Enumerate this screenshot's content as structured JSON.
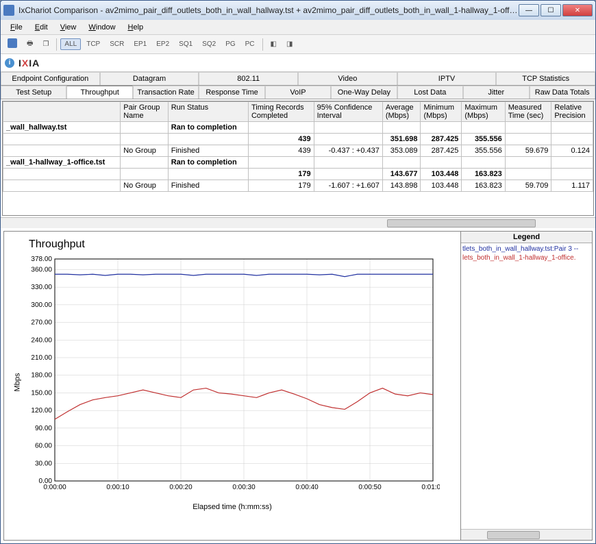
{
  "window": {
    "title": "IxChariot Comparison - av2mimo_pair_diff_outlets_both_in_wall_hallway.tst + av2mimo_pair_diff_outlets_both_in_wall_1-hallway_1-offic..."
  },
  "menu": {
    "file": "File",
    "edit": "Edit",
    "view": "View",
    "window": "Window",
    "help": "Help"
  },
  "toolbar": {
    "save_icon": "disk",
    "print_icon": "print",
    "all": "ALL",
    "tcp": "TCP",
    "scr": "SCR",
    "ep1": "EP1",
    "ep2": "EP2",
    "sq1": "SQ1",
    "sq2": "SQ2",
    "pg": "PG",
    "pc": "PC"
  },
  "brand": {
    "name_left": "I",
    "name_x": "X",
    "name_right": "IA"
  },
  "tabs_top": [
    "Endpoint Configuration",
    "Datagram",
    "802.11",
    "Video",
    "IPTV",
    "TCP Statistics"
  ],
  "tabs_bottom": [
    "Test Setup",
    "Throughput",
    "Transaction Rate",
    "Response Time",
    "VoIP",
    "One-Way Delay",
    "Lost Data",
    "Jitter",
    "Raw Data Totals"
  ],
  "tabs_bottom_selected": 1,
  "grid": {
    "headers": [
      "",
      "Pair Group\nName",
      "Run Status",
      "Timing Records\nCompleted",
      "95% Confidence\nInterval",
      "Average\n(Mbps)",
      "Minimum\n(Mbps)",
      "Maximum\n(Mbps)",
      "Measured\nTime (sec)",
      "Relative\nPrecision"
    ],
    "rows": [
      {
        "bold": true,
        "cells": [
          "_wall_hallway.tst",
          "",
          "Ran to completion",
          "",
          "",
          "",
          "",
          "",
          "",
          ""
        ]
      },
      {
        "bold": true,
        "cells": [
          "",
          "",
          "",
          "439",
          "",
          "351.698",
          "287.425",
          "355.556",
          "",
          ""
        ]
      },
      {
        "cells": [
          "",
          "No Group",
          "Finished",
          "439",
          "-0.437 : +0.437",
          "353.089",
          "287.425",
          "355.556",
          "59.679",
          "0.124"
        ]
      },
      {
        "bold": true,
        "cells": [
          "_wall_1-hallway_1-office.tst",
          "",
          "Ran to completion",
          "",
          "",
          "",
          "",
          "",
          "",
          ""
        ]
      },
      {
        "bold": true,
        "cells": [
          "",
          "",
          "",
          "179",
          "",
          "143.677",
          "103.448",
          "163.823",
          "",
          ""
        ]
      },
      {
        "cells": [
          "",
          "No Group",
          "Finished",
          "179",
          "-1.607 : +1.607",
          "143.898",
          "103.448",
          "163.823",
          "59.709",
          "1.117"
        ]
      }
    ]
  },
  "legend": {
    "title": "Legend",
    "items": [
      "tlets_both_in_wall_hallway.tst:Pair 3 --",
      "lets_both_in_wall_1-hallway_1-office."
    ]
  },
  "chart_data": {
    "type": "line",
    "title": "Throughput",
    "xlabel": "Elapsed time (h:mm:ss)",
    "ylabel": "Mbps",
    "ylim": [
      0,
      378
    ],
    "y_ticks": [
      0.0,
      30.0,
      60.0,
      90.0,
      120.0,
      150.0,
      180.0,
      210.0,
      240.0,
      270.0,
      300.0,
      330.0,
      360.0,
      378.0
    ],
    "x_ticks": [
      "0:00:00",
      "0:00:10",
      "0:00:20",
      "0:00:30",
      "0:00:40",
      "0:00:50",
      "0:01:00"
    ],
    "x": [
      0,
      2,
      4,
      6,
      8,
      10,
      12,
      14,
      16,
      18,
      20,
      22,
      24,
      26,
      28,
      30,
      32,
      34,
      36,
      38,
      40,
      42,
      44,
      46,
      48,
      50,
      52,
      54,
      56,
      58,
      60
    ],
    "series": [
      {
        "name": "wall_hallway",
        "color": "#2030a0",
        "values": [
          352,
          352,
          351,
          352,
          350,
          352,
          352,
          351,
          352,
          352,
          352,
          350,
          352,
          352,
          352,
          352,
          350,
          352,
          352,
          352,
          352,
          351,
          352,
          348,
          352,
          352,
          352,
          352,
          352,
          352,
          352
        ]
      },
      {
        "name": "wall_1-hallway_1-office",
        "color": "#c03030",
        "values": [
          105,
          118,
          130,
          138,
          142,
          145,
          150,
          155,
          150,
          145,
          142,
          155,
          158,
          150,
          148,
          145,
          142,
          150,
          155,
          148,
          140,
          130,
          125,
          122,
          135,
          150,
          158,
          148,
          145,
          150,
          147
        ]
      }
    ]
  }
}
